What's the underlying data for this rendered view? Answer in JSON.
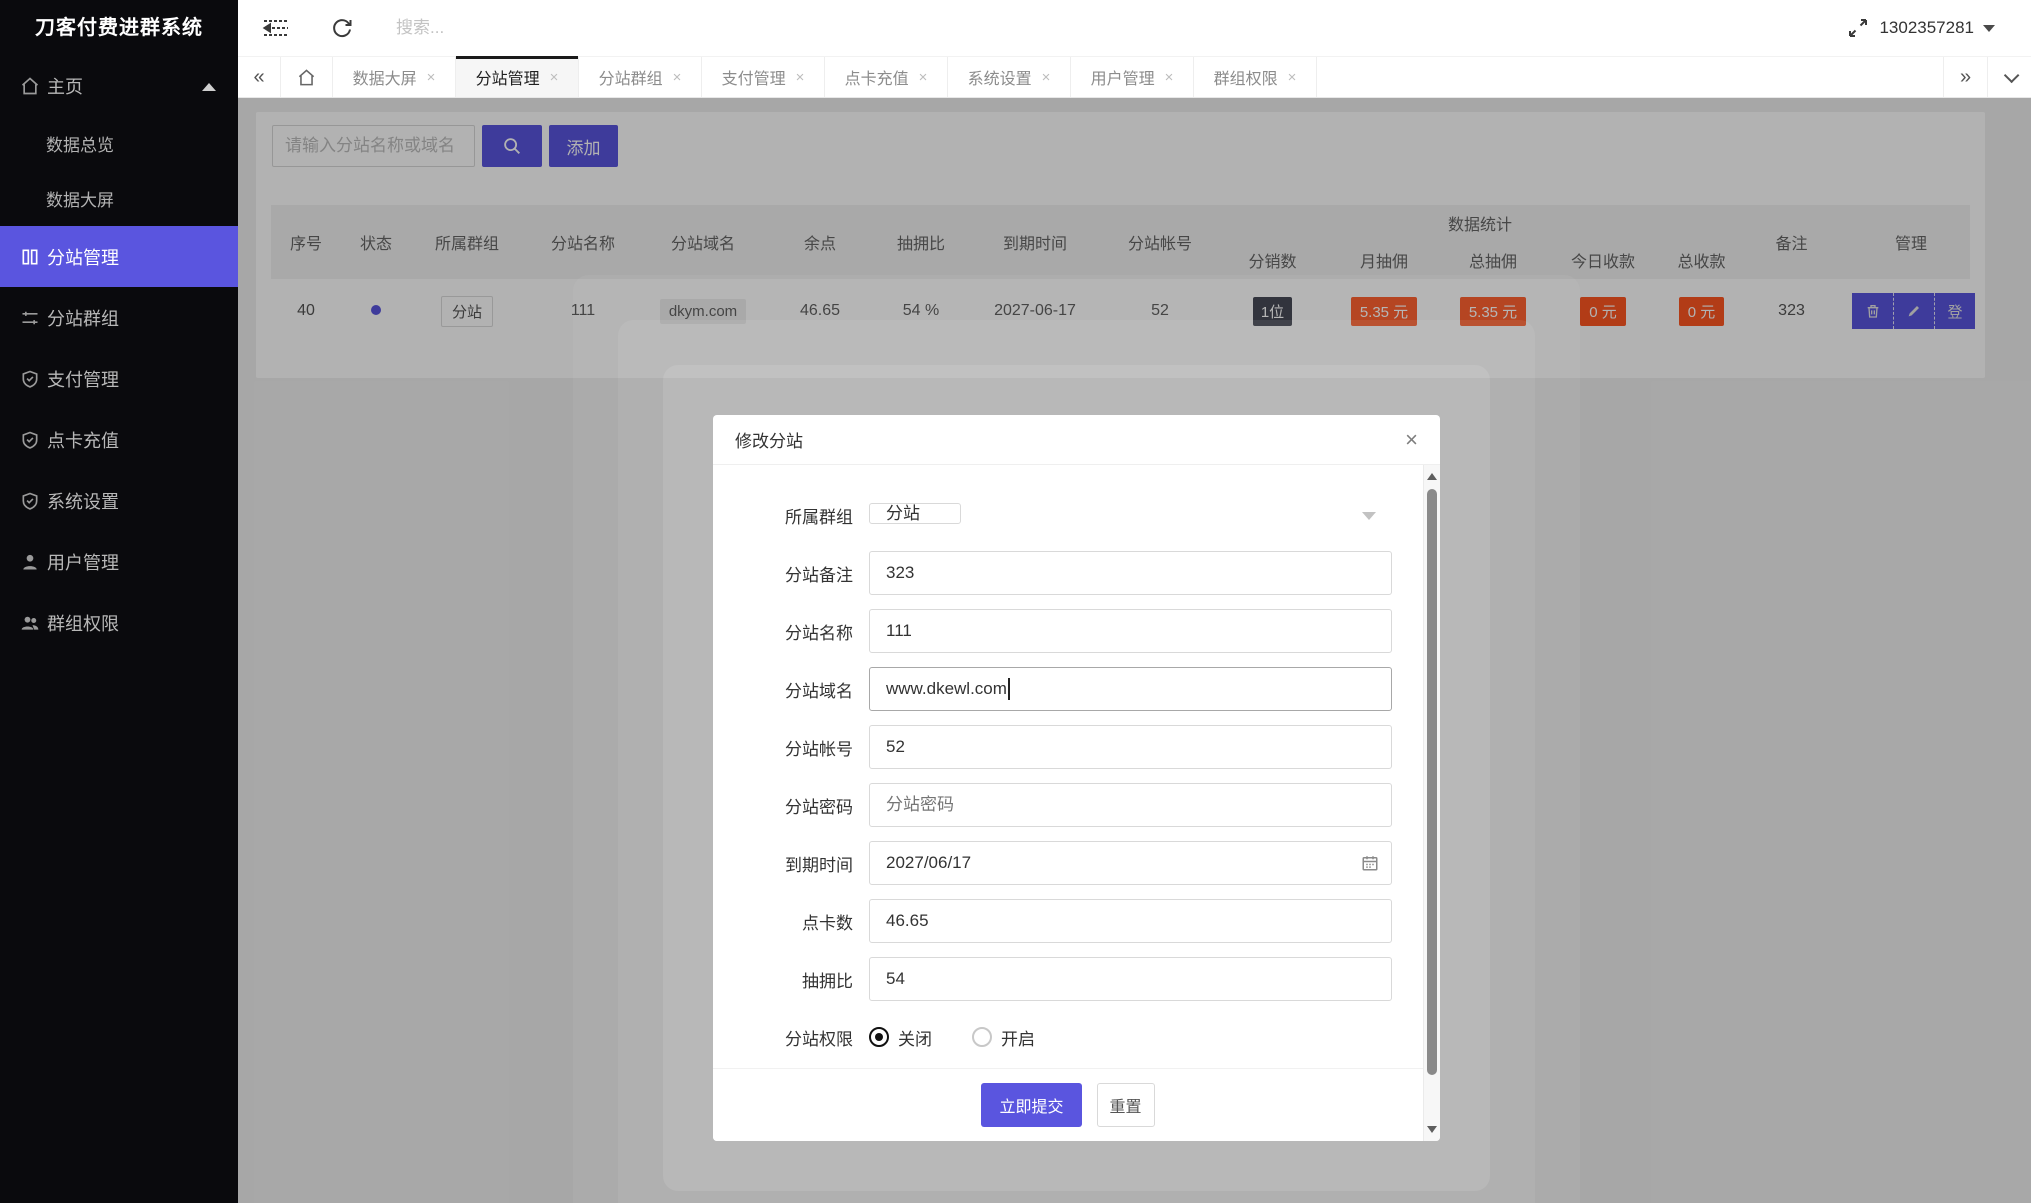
{
  "app": {
    "title": "刀客付费进群系统"
  },
  "colors": {
    "accent": "#5a55df",
    "danger": "#ff5722",
    "dark_badge": "#393d49",
    "sidebar_bg": "#0a0a0d",
    "shade": "rgba(0,0,0,0.30)"
  },
  "topbar": {
    "search_placeholder": "搜索...",
    "user_id": "1302357281",
    "icons": [
      "collapse-menu-icon",
      "refresh-icon",
      "fullscreen-icon",
      "caret-down-icon"
    ]
  },
  "sidebar": {
    "items": [
      {
        "label": "主页",
        "icon": "home-icon",
        "expanded": true
      },
      {
        "label": "数据总览",
        "icon": null
      },
      {
        "label": "数据大屏",
        "icon": null
      },
      {
        "label": "分站管理",
        "icon": "book-icon",
        "active": true
      },
      {
        "label": "分站群组",
        "icon": "sliders-icon"
      },
      {
        "label": "支付管理",
        "icon": "shield-check-icon"
      },
      {
        "label": "点卡充值",
        "icon": "shield-check-icon"
      },
      {
        "label": "系统设置",
        "icon": "shield-check-icon"
      },
      {
        "label": "用户管理",
        "icon": "user-icon"
      },
      {
        "label": "群组权限",
        "icon": "users-icon"
      }
    ]
  },
  "tabs": {
    "prev": "«",
    "next": "»",
    "items": [
      {
        "label": "数据大屏"
      },
      {
        "label": "分站管理",
        "active": true
      },
      {
        "label": "分站群组"
      },
      {
        "label": "支付管理"
      },
      {
        "label": "点卡充值"
      },
      {
        "label": "系统设置"
      },
      {
        "label": "用户管理"
      },
      {
        "label": "群组权限"
      }
    ],
    "close_glyph": "×"
  },
  "toolbar": {
    "search_placeholder": "请输入分站名称或域名",
    "add_label": "添加"
  },
  "table": {
    "headers": {
      "seq": "序号",
      "status": "状态",
      "group": "所属群组",
      "name": "分站名称",
      "domain": "分站域名",
      "balance": "余点",
      "commission_rate": "抽拥比",
      "expire": "到期时间",
      "account": "分站帐号",
      "stats_group": "数据统计",
      "dist_count": "分销数",
      "month_commission": "月抽佣",
      "total_commission": "总抽佣",
      "today_income": "今日收款",
      "total_income": "总收款",
      "remark": "备注",
      "manage": "管理"
    },
    "row": {
      "seq": "40",
      "group_tag": "分站",
      "name": "111",
      "domain": "dkym.com",
      "balance": "46.65",
      "commission_rate": "54 %",
      "expire": "2027-06-17",
      "account": "52",
      "dist_count": "1位",
      "month_commission": "5.35 元",
      "total_commission": "5.35 元",
      "today_income": "0 元",
      "total_income": "0 元",
      "remark": "323",
      "actions": {
        "delete": "trash-icon",
        "edit": "pencil-icon",
        "login_label": "登"
      }
    }
  },
  "modal": {
    "title": "修改分站",
    "close_glyph": "×",
    "fields": {
      "group": {
        "label": "所属群组",
        "value": "分站"
      },
      "remark": {
        "label": "分站备注",
        "value": "323"
      },
      "name": {
        "label": "分站名称",
        "value": "111"
      },
      "domain": {
        "label": "分站域名",
        "value": "www.dkewl.com",
        "focused": true
      },
      "account": {
        "label": "分站帐号",
        "value": "52"
      },
      "password": {
        "label": "分站密码",
        "placeholder": "分站密码"
      },
      "expire": {
        "label": "到期时间",
        "value": "2027/06/17"
      },
      "points": {
        "label": "点卡数",
        "value": "46.65"
      },
      "commission": {
        "label": "抽拥比",
        "value": "54"
      }
    },
    "permission": {
      "label": "分站权限",
      "off_label": "关闭",
      "on_label": "开启",
      "selected": "off"
    },
    "submit_label": "立即提交",
    "reset_label": "重置"
  }
}
